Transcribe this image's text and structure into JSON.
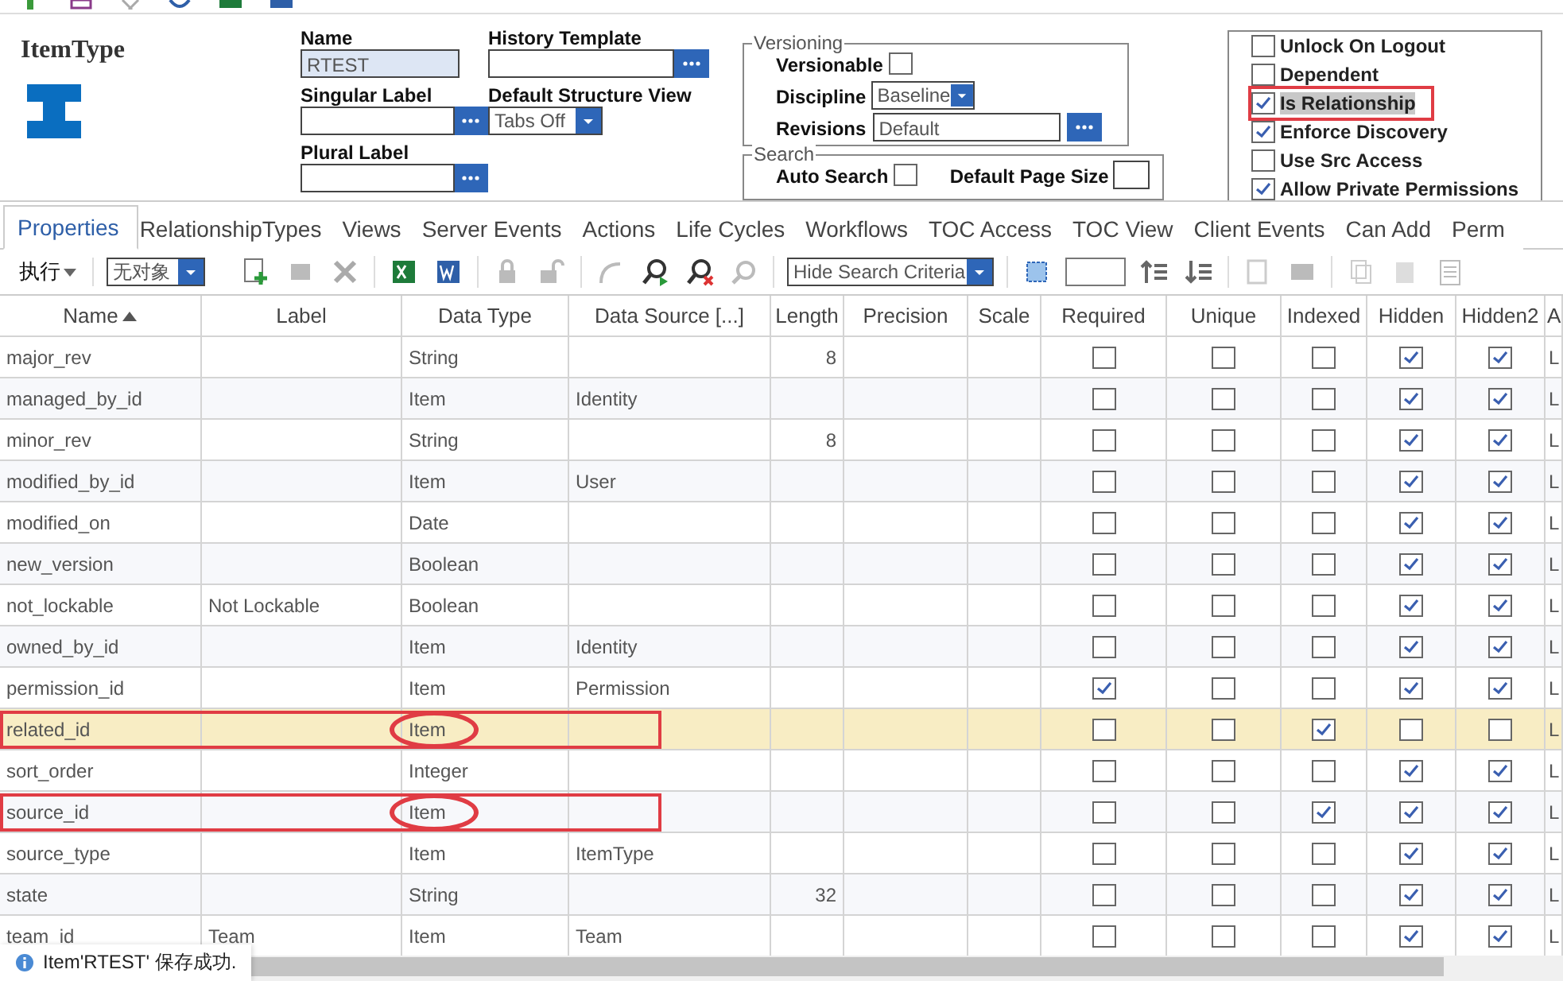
{
  "header": {
    "title": "ItemType"
  },
  "fields": {
    "name": {
      "label": "Name",
      "value": "RTEST"
    },
    "history_template": {
      "label": "History Template"
    },
    "singular_label": {
      "label": "Singular Label"
    },
    "default_structure_view": {
      "label": "Default Structure View",
      "value": "Tabs Off"
    },
    "plural_label": {
      "label": "Plural Label"
    }
  },
  "versioning": {
    "legend": "Versioning",
    "versionable": {
      "label": "Versionable",
      "checked": false
    },
    "discipline": {
      "label": "Discipline",
      "value": "Baseline"
    },
    "revisions": {
      "label": "Revisions",
      "value": "Default"
    }
  },
  "search": {
    "legend": "Search",
    "auto_search": {
      "label": "Auto Search",
      "checked": false
    },
    "default_page_size": {
      "label": "Default Page Size"
    }
  },
  "options": [
    {
      "label": "Unlock On Logout",
      "checked": false,
      "annotated": false
    },
    {
      "label": "Dependent",
      "checked": false,
      "annotated": false
    },
    {
      "label": "Is Relationship",
      "checked": true,
      "annotated": true
    },
    {
      "label": "Enforce Discovery",
      "checked": true,
      "annotated": false
    },
    {
      "label": "Use Src Access",
      "checked": false,
      "annotated": false
    },
    {
      "label": "Allow Private Permissions",
      "checked": true,
      "annotated": false
    }
  ],
  "tabs": [
    {
      "label": "Properties",
      "selected": true
    },
    {
      "label": "RelationshipTypes",
      "selected": false
    },
    {
      "label": "Views",
      "selected": false
    },
    {
      "label": "Server Events",
      "selected": false
    },
    {
      "label": "Actions",
      "selected": false
    },
    {
      "label": "Life Cycles",
      "selected": false
    },
    {
      "label": "Workflows",
      "selected": false
    },
    {
      "label": "TOC Access",
      "selected": false
    },
    {
      "label": "TOC View",
      "selected": false
    },
    {
      "label": "Client Events",
      "selected": false
    },
    {
      "label": "Can Add",
      "selected": false
    },
    {
      "label": "Perm",
      "selected": false
    }
  ],
  "grid_toolbar": {
    "execute": "执行",
    "object_select": "无对象",
    "criteria_select": "Hide Search Criteria"
  },
  "table": {
    "columns": [
      "Name",
      "Label",
      "Data Type",
      "Data Source [...]",
      "Length",
      "Precision",
      "Scale",
      "Required",
      "Unique",
      "Indexed",
      "Hidden",
      "Hidden2",
      "A"
    ],
    "rows": [
      {
        "name": "major_rev",
        "label": "",
        "data_type": "String",
        "data_source": "",
        "length": "8",
        "required": false,
        "unique": false,
        "indexed": false,
        "hidden": true,
        "hidden2": true,
        "column_13": "L",
        "selected": false,
        "annotated": false
      },
      {
        "name": "managed_by_id",
        "label": "",
        "data_type": "Item",
        "data_source": "Identity",
        "length": "",
        "required": false,
        "unique": false,
        "indexed": false,
        "hidden": true,
        "hidden2": true,
        "column_13": "L",
        "selected": false,
        "annotated": false
      },
      {
        "name": "minor_rev",
        "label": "",
        "data_type": "String",
        "data_source": "",
        "length": "8",
        "required": false,
        "unique": false,
        "indexed": false,
        "hidden": true,
        "hidden2": true,
        "column_13": "L",
        "selected": false,
        "annotated": false
      },
      {
        "name": "modified_by_id",
        "label": "",
        "data_type": "Item",
        "data_source": "User",
        "length": "",
        "required": false,
        "unique": false,
        "indexed": false,
        "hidden": true,
        "hidden2": true,
        "column_13": "L",
        "selected": false,
        "annotated": false
      },
      {
        "name": "modified_on",
        "label": "",
        "data_type": "Date",
        "data_source": "",
        "length": "",
        "required": false,
        "unique": false,
        "indexed": false,
        "hidden": true,
        "hidden2": true,
        "column_13": "L",
        "selected": false,
        "annotated": false
      },
      {
        "name": "new_version",
        "label": "",
        "data_type": "Boolean",
        "data_source": "",
        "length": "",
        "required": false,
        "unique": false,
        "indexed": false,
        "hidden": true,
        "hidden2": true,
        "column_13": "L",
        "selected": false,
        "annotated": false
      },
      {
        "name": "not_lockable",
        "label": "Not Lockable",
        "data_type": "Boolean",
        "data_source": "",
        "length": "",
        "required": false,
        "unique": false,
        "indexed": false,
        "hidden": true,
        "hidden2": true,
        "column_13": "L",
        "selected": false,
        "annotated": false
      },
      {
        "name": "owned_by_id",
        "label": "",
        "data_type": "Item",
        "data_source": "Identity",
        "length": "",
        "required": false,
        "unique": false,
        "indexed": false,
        "hidden": true,
        "hidden2": true,
        "column_13": "L",
        "selected": false,
        "annotated": false
      },
      {
        "name": "permission_id",
        "label": "",
        "data_type": "Item",
        "data_source": "Permission",
        "length": "",
        "required": true,
        "unique": false,
        "indexed": false,
        "hidden": true,
        "hidden2": true,
        "column_13": "L",
        "selected": false,
        "annotated": false
      },
      {
        "name": "related_id",
        "label": "",
        "data_type": "Item",
        "data_source": "",
        "length": "",
        "required": false,
        "unique": false,
        "indexed": true,
        "hidden": false,
        "hidden2": false,
        "column_13": "L",
        "selected": true,
        "annotated": true
      },
      {
        "name": "sort_order",
        "label": "",
        "data_type": "Integer",
        "data_source": "",
        "length": "",
        "required": false,
        "unique": false,
        "indexed": false,
        "hidden": true,
        "hidden2": true,
        "column_13": "L",
        "selected": false,
        "annotated": false
      },
      {
        "name": "source_id",
        "label": "",
        "data_type": "Item",
        "data_source": "",
        "length": "",
        "required": false,
        "unique": false,
        "indexed": true,
        "hidden": true,
        "hidden2": true,
        "column_13": "L",
        "selected": false,
        "annotated": true
      },
      {
        "name": "source_type",
        "label": "",
        "data_type": "Item",
        "data_source": "ItemType",
        "length": "",
        "required": false,
        "unique": false,
        "indexed": false,
        "hidden": true,
        "hidden2": true,
        "column_13": "L",
        "selected": false,
        "annotated": false
      },
      {
        "name": "state",
        "label": "",
        "data_type": "String",
        "data_source": "",
        "length": "32",
        "required": false,
        "unique": false,
        "indexed": false,
        "hidden": true,
        "hidden2": true,
        "column_13": "L",
        "selected": false,
        "annotated": false
      },
      {
        "name": "team_id",
        "label": "Team",
        "data_type": "Item",
        "data_source": "Team",
        "length": "",
        "required": false,
        "unique": false,
        "indexed": false,
        "hidden": true,
        "hidden2": true,
        "column_13": "L",
        "selected": false,
        "annotated": false
      }
    ]
  },
  "status": {
    "message": "Item'RTEST' 保存成功."
  }
}
